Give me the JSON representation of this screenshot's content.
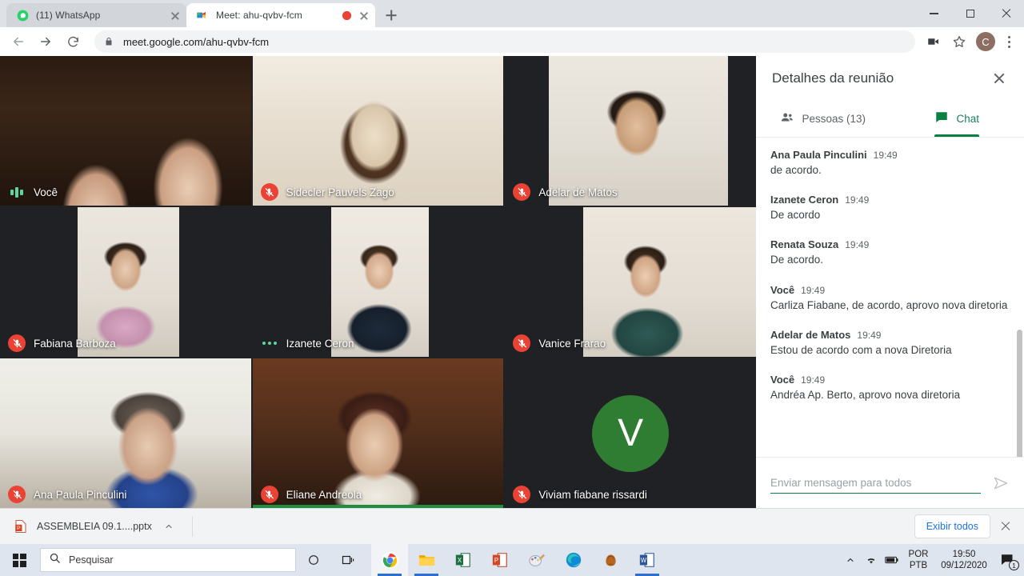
{
  "browser": {
    "tabs": [
      {
        "title": "(11) WhatsApp",
        "favicon": "whatsapp-icon",
        "active": false,
        "recording": false
      },
      {
        "title": "Meet: ahu-qvbv-fcm",
        "favicon": "google-meet-icon",
        "active": true,
        "recording": true
      }
    ],
    "new_tab_label": "+",
    "url": "meet.google.com/ahu-qvbv-fcm",
    "profile_initial": "C",
    "window_controls": [
      "minimize",
      "maximize",
      "close"
    ]
  },
  "meeting": {
    "participants": [
      {
        "name": "Você",
        "muted": false,
        "speaking": true,
        "audio_indicator": "audio-bars",
        "avatar": null,
        "bg": "#191410"
      },
      {
        "name": "Sidecler Pauvels Zago",
        "muted": true,
        "speaking": false,
        "audio_indicator": "mic-off",
        "avatar": null,
        "bg": "#2b2b2b"
      },
      {
        "name": "Adelar de Matos",
        "muted": true,
        "speaking": false,
        "audio_indicator": "mic-off",
        "avatar": null,
        "bg": "#202124"
      },
      {
        "name": "Fabiana Barboza",
        "muted": true,
        "speaking": false,
        "audio_indicator": "mic-off",
        "avatar": null,
        "bg": "#202124"
      },
      {
        "name": "Izanete Ceron",
        "muted": false,
        "speaking": true,
        "audio_indicator": "three-dots",
        "avatar": null,
        "bg": "#202124"
      },
      {
        "name": "Vanice Frarao",
        "muted": true,
        "speaking": false,
        "audio_indicator": "mic-off",
        "avatar": null,
        "bg": "#202124"
      },
      {
        "name": "Ana Paula Pinculini",
        "muted": true,
        "speaking": false,
        "audio_indicator": "mic-off",
        "avatar": null,
        "bg": "#1b1714"
      },
      {
        "name": "Eliane Andreola",
        "muted": true,
        "speaking": true,
        "audio_indicator": "mic-off",
        "avatar": null,
        "bg": "#25201c"
      },
      {
        "name": "Viviam fiabane rissardi",
        "muted": true,
        "speaking": false,
        "audio_indicator": "mic-off",
        "avatar": "V",
        "bg": "#202124"
      }
    ],
    "avatar_color": "#2e7d32"
  },
  "panel": {
    "title": "Detalhes da reunião",
    "close_label": "close-icon",
    "tabs": [
      {
        "label": "Pessoas (13)",
        "icon": "people-icon",
        "active": false
      },
      {
        "label": "Chat",
        "icon": "chat-icon",
        "active": true
      }
    ],
    "accent_color": "#0b8043",
    "messages": [
      {
        "author": "Ana Paula Pinculini",
        "time": "19:49",
        "text": "de acordo."
      },
      {
        "author": "Izanete Ceron",
        "time": "19:49",
        "text": "De acordo"
      },
      {
        "author": "Renata Souza",
        "time": "19:49",
        "text": "De acordo."
      },
      {
        "author": "Você",
        "time": "19:49",
        "text": "Carliza Fiabane, de acordo, aprovo nova diretoria"
      },
      {
        "author": "Adelar de Matos",
        "time": "19:49",
        "text": "Estou de acordo com a nova Diretoria"
      },
      {
        "author": "Você",
        "time": "19:49",
        "text": "Andréa Ap. Berto, aprovo nova diretoria"
      }
    ],
    "composer": {
      "placeholder": "Enviar mensagem para todos",
      "value": "",
      "send_label": "send-icon"
    }
  },
  "downloads": {
    "file_name": "ASSEMBLEIA 09.1....pptx",
    "file_icon": "powerpoint-file-icon",
    "show_all_label": "Exibir todos",
    "close_label": "close-icon"
  },
  "taskbar": {
    "start_label": "windows-start-icon",
    "search_placeholder": "Pesquisar",
    "system_icons": [
      "cortana-icon",
      "task-view-icon"
    ],
    "apps": [
      {
        "name": "chrome-icon",
        "open": true
      },
      {
        "name": "file-explorer-icon",
        "open": true
      },
      {
        "name": "excel-icon",
        "open": false
      },
      {
        "name": "powerpoint-icon",
        "open": false
      },
      {
        "name": "paint-icon",
        "open": false
      },
      {
        "name": "edge-icon",
        "open": false
      },
      {
        "name": "glove-app-icon",
        "open": false
      },
      {
        "name": "word-icon",
        "open": true
      }
    ],
    "tray": {
      "show_hidden": "chevron-up-icon",
      "network": "wifi-icon",
      "battery": "battery-icon",
      "lang_line1": "POR",
      "lang_line2": "PTB",
      "time": "19:50",
      "date": "09/12/2020",
      "notification_count": "1"
    }
  }
}
